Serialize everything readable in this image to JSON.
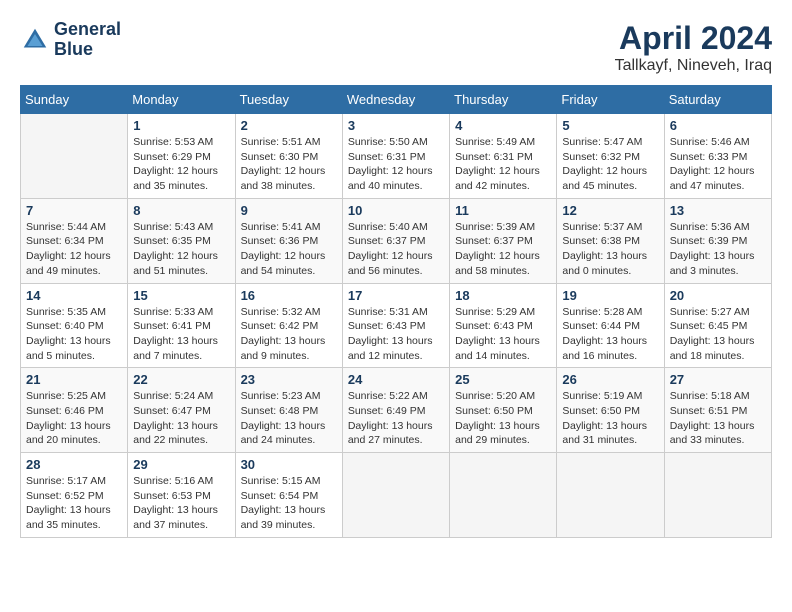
{
  "header": {
    "logo_line1": "General",
    "logo_line2": "Blue",
    "month_year": "April 2024",
    "location": "Tallkayf, Nineveh, Iraq"
  },
  "weekdays": [
    "Sunday",
    "Monday",
    "Tuesday",
    "Wednesday",
    "Thursday",
    "Friday",
    "Saturday"
  ],
  "weeks": [
    [
      {
        "day": "",
        "empty": true
      },
      {
        "day": "1",
        "sunrise": "5:53 AM",
        "sunset": "6:29 PM",
        "daylight": "12 hours and 35 minutes."
      },
      {
        "day": "2",
        "sunrise": "5:51 AM",
        "sunset": "6:30 PM",
        "daylight": "12 hours and 38 minutes."
      },
      {
        "day": "3",
        "sunrise": "5:50 AM",
        "sunset": "6:31 PM",
        "daylight": "12 hours and 40 minutes."
      },
      {
        "day": "4",
        "sunrise": "5:49 AM",
        "sunset": "6:31 PM",
        "daylight": "12 hours and 42 minutes."
      },
      {
        "day": "5",
        "sunrise": "5:47 AM",
        "sunset": "6:32 PM",
        "daylight": "12 hours and 45 minutes."
      },
      {
        "day": "6",
        "sunrise": "5:46 AM",
        "sunset": "6:33 PM",
        "daylight": "12 hours and 47 minutes."
      }
    ],
    [
      {
        "day": "7",
        "sunrise": "5:44 AM",
        "sunset": "6:34 PM",
        "daylight": "12 hours and 49 minutes."
      },
      {
        "day": "8",
        "sunrise": "5:43 AM",
        "sunset": "6:35 PM",
        "daylight": "12 hours and 51 minutes."
      },
      {
        "day": "9",
        "sunrise": "5:41 AM",
        "sunset": "6:36 PM",
        "daylight": "12 hours and 54 minutes."
      },
      {
        "day": "10",
        "sunrise": "5:40 AM",
        "sunset": "6:37 PM",
        "daylight": "12 hours and 56 minutes."
      },
      {
        "day": "11",
        "sunrise": "5:39 AM",
        "sunset": "6:37 PM",
        "daylight": "12 hours and 58 minutes."
      },
      {
        "day": "12",
        "sunrise": "5:37 AM",
        "sunset": "6:38 PM",
        "daylight": "13 hours and 0 minutes."
      },
      {
        "day": "13",
        "sunrise": "5:36 AM",
        "sunset": "6:39 PM",
        "daylight": "13 hours and 3 minutes."
      }
    ],
    [
      {
        "day": "14",
        "sunrise": "5:35 AM",
        "sunset": "6:40 PM",
        "daylight": "13 hours and 5 minutes."
      },
      {
        "day": "15",
        "sunrise": "5:33 AM",
        "sunset": "6:41 PM",
        "daylight": "13 hours and 7 minutes."
      },
      {
        "day": "16",
        "sunrise": "5:32 AM",
        "sunset": "6:42 PM",
        "daylight": "13 hours and 9 minutes."
      },
      {
        "day": "17",
        "sunrise": "5:31 AM",
        "sunset": "6:43 PM",
        "daylight": "13 hours and 12 minutes."
      },
      {
        "day": "18",
        "sunrise": "5:29 AM",
        "sunset": "6:43 PM",
        "daylight": "13 hours and 14 minutes."
      },
      {
        "day": "19",
        "sunrise": "5:28 AM",
        "sunset": "6:44 PM",
        "daylight": "13 hours and 16 minutes."
      },
      {
        "day": "20",
        "sunrise": "5:27 AM",
        "sunset": "6:45 PM",
        "daylight": "13 hours and 18 minutes."
      }
    ],
    [
      {
        "day": "21",
        "sunrise": "5:25 AM",
        "sunset": "6:46 PM",
        "daylight": "13 hours and 20 minutes."
      },
      {
        "day": "22",
        "sunrise": "5:24 AM",
        "sunset": "6:47 PM",
        "daylight": "13 hours and 22 minutes."
      },
      {
        "day": "23",
        "sunrise": "5:23 AM",
        "sunset": "6:48 PM",
        "daylight": "13 hours and 24 minutes."
      },
      {
        "day": "24",
        "sunrise": "5:22 AM",
        "sunset": "6:49 PM",
        "daylight": "13 hours and 27 minutes."
      },
      {
        "day": "25",
        "sunrise": "5:20 AM",
        "sunset": "6:50 PM",
        "daylight": "13 hours and 29 minutes."
      },
      {
        "day": "26",
        "sunrise": "5:19 AM",
        "sunset": "6:50 PM",
        "daylight": "13 hours and 31 minutes."
      },
      {
        "day": "27",
        "sunrise": "5:18 AM",
        "sunset": "6:51 PM",
        "daylight": "13 hours and 33 minutes."
      }
    ],
    [
      {
        "day": "28",
        "sunrise": "5:17 AM",
        "sunset": "6:52 PM",
        "daylight": "13 hours and 35 minutes."
      },
      {
        "day": "29",
        "sunrise": "5:16 AM",
        "sunset": "6:53 PM",
        "daylight": "13 hours and 37 minutes."
      },
      {
        "day": "30",
        "sunrise": "5:15 AM",
        "sunset": "6:54 PM",
        "daylight": "13 hours and 39 minutes."
      },
      {
        "day": "",
        "empty": true
      },
      {
        "day": "",
        "empty": true
      },
      {
        "day": "",
        "empty": true
      },
      {
        "day": "",
        "empty": true
      }
    ]
  ],
  "labels": {
    "sunrise": "Sunrise:",
    "sunset": "Sunset:",
    "daylight": "Daylight:"
  }
}
